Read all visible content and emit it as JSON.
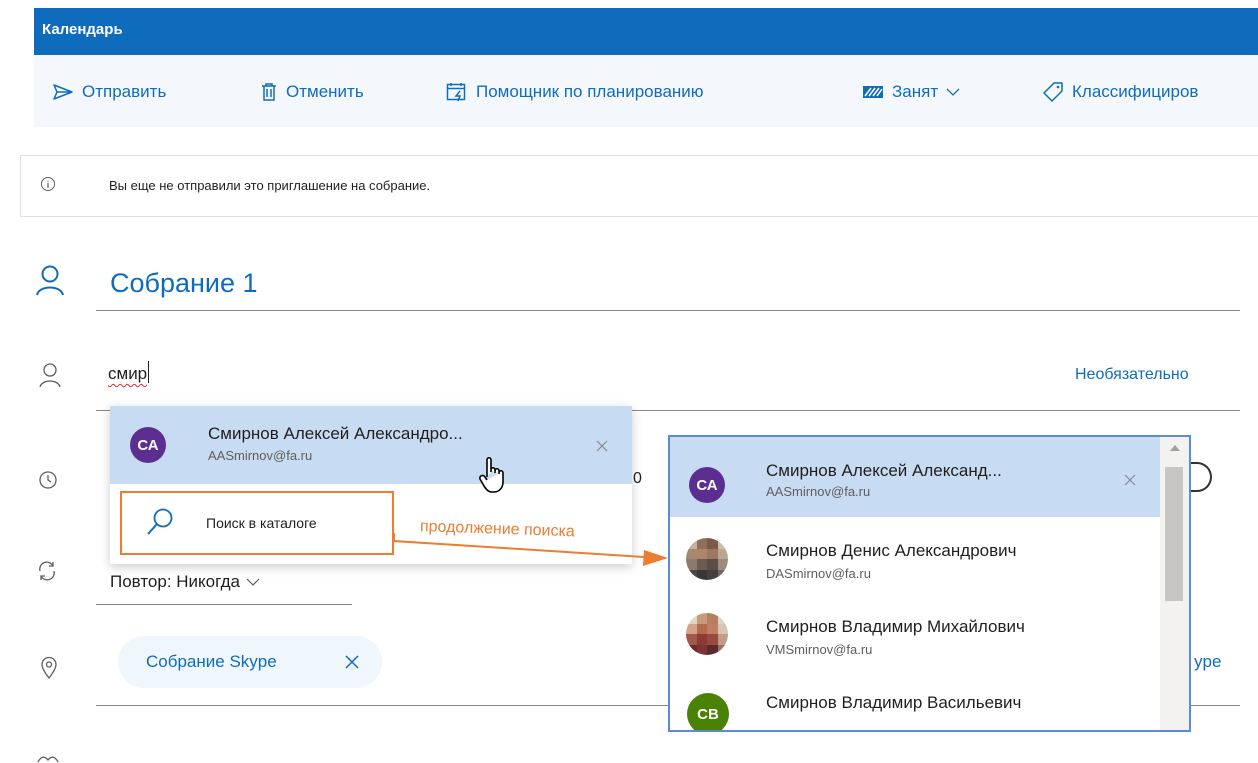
{
  "app": {
    "title": "Календарь"
  },
  "toolbar": {
    "send_label": "Отправить",
    "cancel_label": "Отменить",
    "scheduling_label": "Помощник по планированию",
    "busy_label": "Занят",
    "classify_label": "Классифициров"
  },
  "info_bar": {
    "message": "Вы еще не отправили это приглашение на собрание."
  },
  "event": {
    "title": "Собрание 1"
  },
  "attendees": {
    "input_value": "смир",
    "optional_label": "Необязательно"
  },
  "suggestion_dropdown": {
    "selected": {
      "initials": "СА",
      "name": "Смирнов Алексей Александро...",
      "email": "AASmirnov@fa.ru"
    },
    "directory_search_label": "Поиск в каталоге"
  },
  "time": {
    "visible_digit": "0"
  },
  "repeat": {
    "label": "Повтор: Никогда"
  },
  "location": {
    "chip_label": "Собрание Skype",
    "right_fragment": "ype"
  },
  "annotation": {
    "label": "продолжение поиска"
  },
  "directory_results": [
    {
      "kind": "initials",
      "initials": "СА",
      "color": "#5c2e91",
      "name": "Смирнов Алексей Александ...",
      "email": "AASmirnov@fa.ru",
      "selected": true
    },
    {
      "kind": "photo",
      "name": "Смирнов Денис Александрович",
      "email": "DASmirnov@fa.ru",
      "selected": false
    },
    {
      "kind": "photo",
      "name": "Смирнов Владимир Михайлович",
      "email": "VMSmirnov@fa.ru",
      "selected": false
    },
    {
      "kind": "initials",
      "initials": "СВ",
      "color": "#498205",
      "name": "Смирнов Владимир Васильевич",
      "email": "",
      "selected": false
    }
  ],
  "colors": {
    "accent": "#0f6cbd",
    "avatar_purple": "#5c2e91",
    "avatar_green": "#498205",
    "annotation_orange": "#ed7d31",
    "selection": "#c7dbf2"
  },
  "icons": [
    "send-icon",
    "trash-icon",
    "calendar-assistant-icon",
    "busy-status-icon",
    "chevron-down-icon",
    "tag-icon",
    "info-icon",
    "person-icon",
    "clock-icon",
    "search-icon",
    "close-icon",
    "repeat-icon",
    "location-icon",
    "hand-cursor-icon"
  ]
}
